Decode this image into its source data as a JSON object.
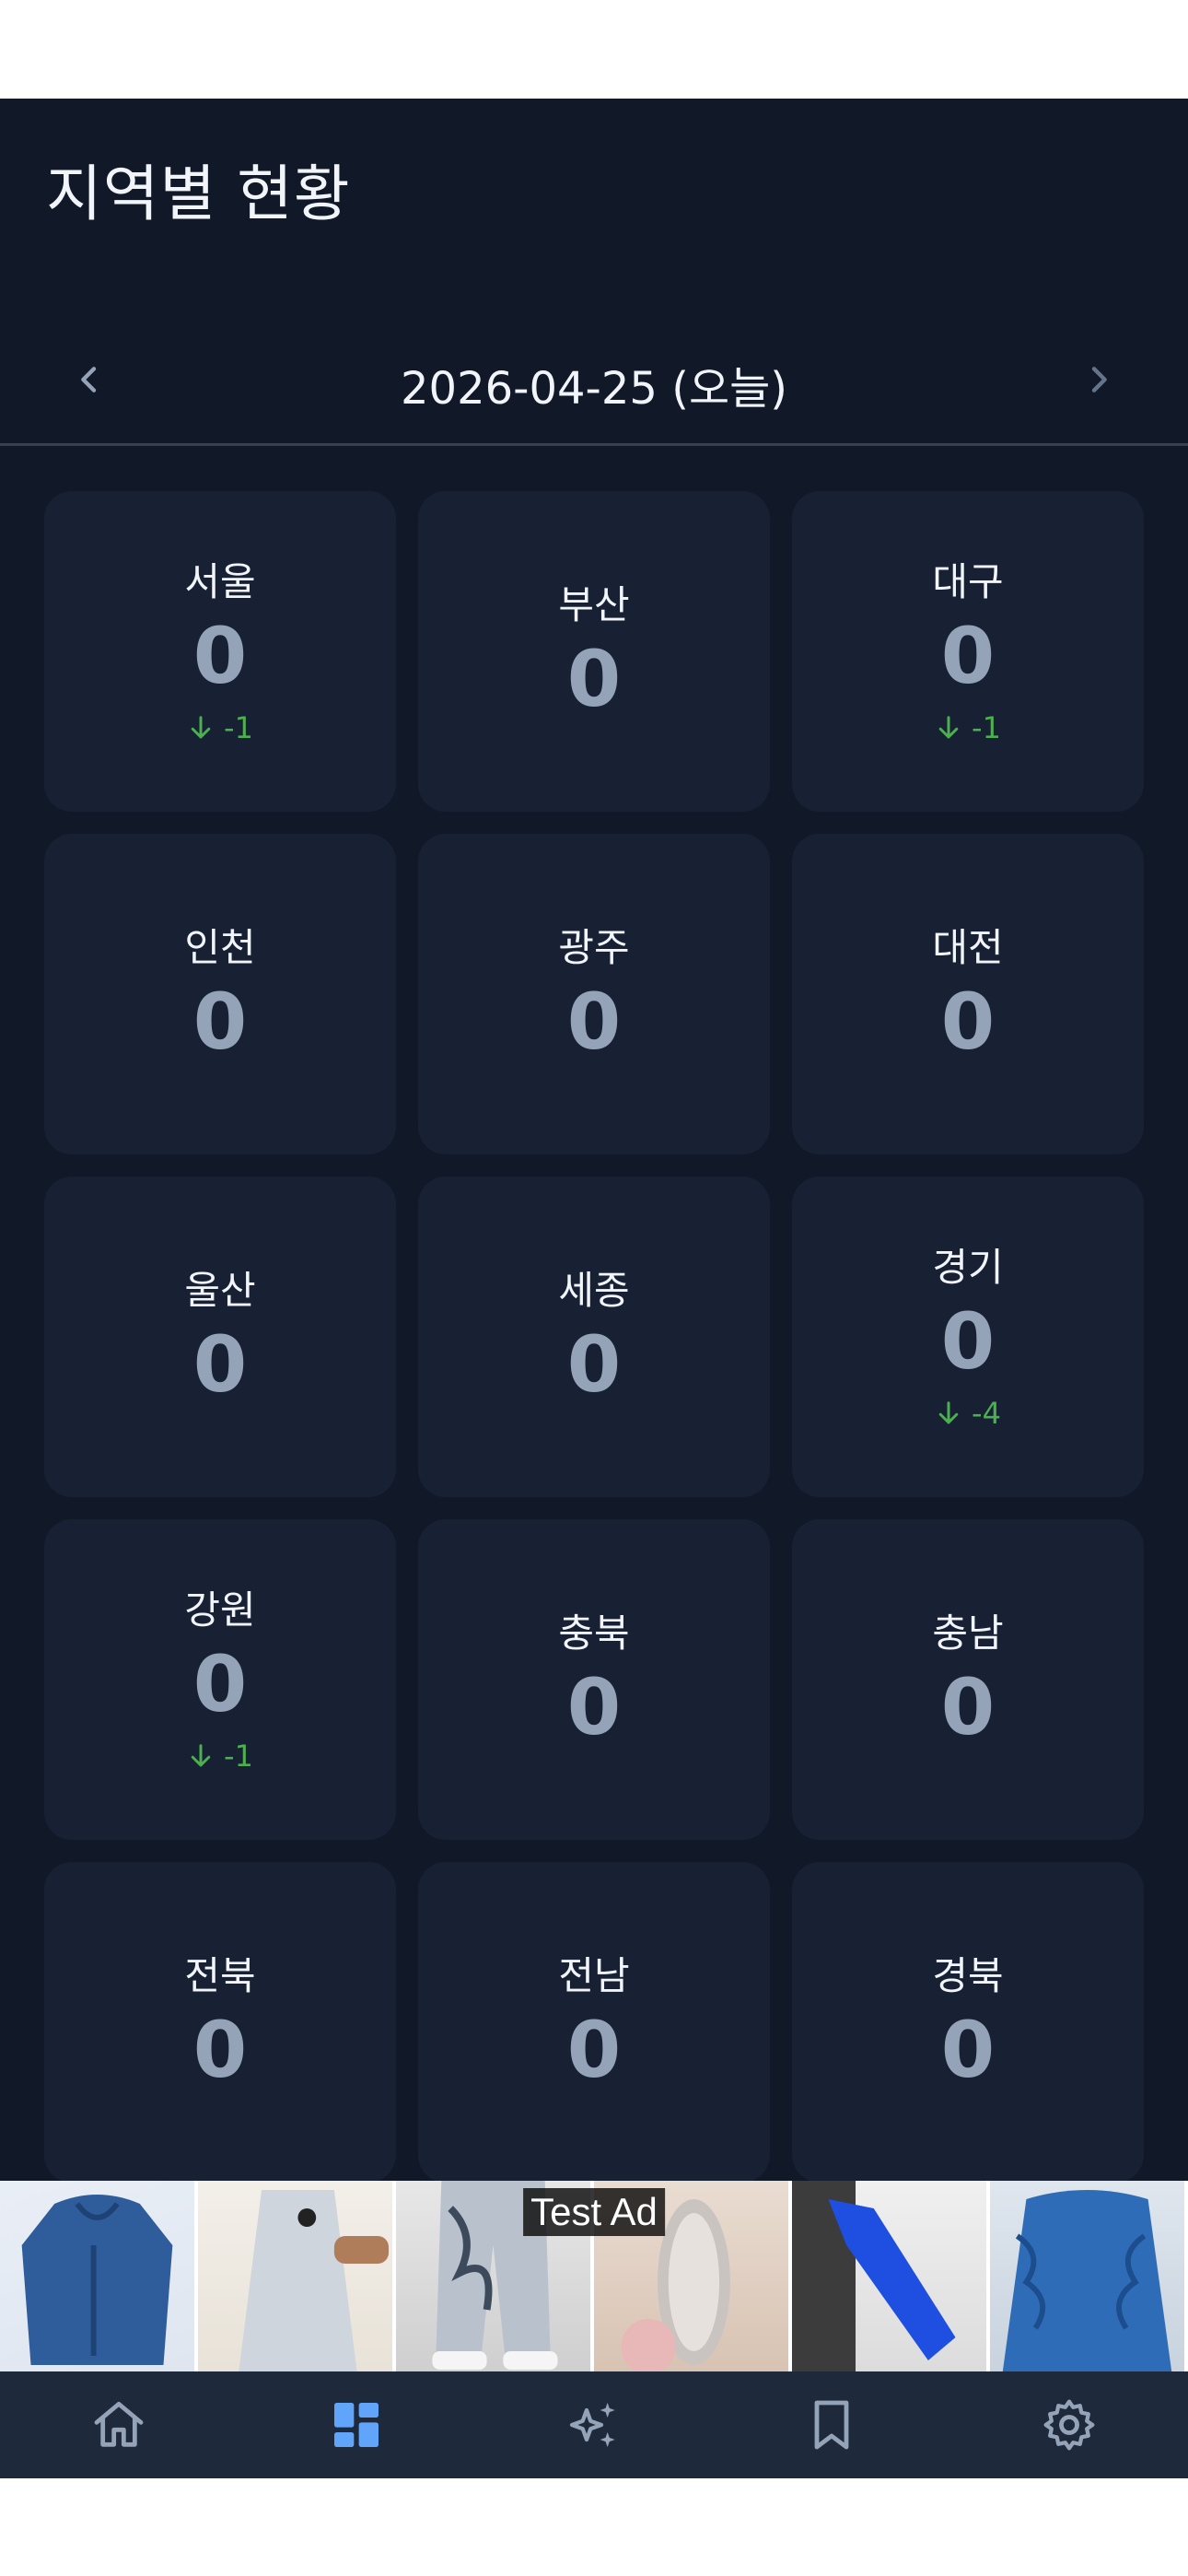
{
  "header": {
    "title": "지역별 현황"
  },
  "date_nav": {
    "label": "2026-04-25 (오늘)",
    "prev_icon": "chevron-left-icon",
    "next_icon": "chevron-right-icon"
  },
  "colors": {
    "background": "#111827",
    "card": "#182033",
    "value": "#94a3b8",
    "delta_down": "#4caf50",
    "nav_active": "#60a5fa",
    "nav_inactive": "#94a3b8"
  },
  "regions": [
    {
      "name": "서울",
      "value": "0",
      "delta": "-1"
    },
    {
      "name": "부산",
      "value": "0",
      "delta": ""
    },
    {
      "name": "대구",
      "value": "0",
      "delta": "-1"
    },
    {
      "name": "인천",
      "value": "0",
      "delta": ""
    },
    {
      "name": "광주",
      "value": "0",
      "delta": ""
    },
    {
      "name": "대전",
      "value": "0",
      "delta": ""
    },
    {
      "name": "울산",
      "value": "0",
      "delta": ""
    },
    {
      "name": "세종",
      "value": "0",
      "delta": ""
    },
    {
      "name": "경기",
      "value": "0",
      "delta": "-4"
    },
    {
      "name": "강원",
      "value": "0",
      "delta": "-1"
    },
    {
      "name": "충북",
      "value": "0",
      "delta": ""
    },
    {
      "name": "충남",
      "value": "0",
      "delta": ""
    },
    {
      "name": "전북",
      "value": "0",
      "delta": ""
    },
    {
      "name": "전남",
      "value": "0",
      "delta": ""
    },
    {
      "name": "경북",
      "value": "0",
      "delta": ""
    }
  ],
  "ad": {
    "label": "Test Ad"
  },
  "bottom_nav": [
    {
      "icon": "home-icon",
      "active": false
    },
    {
      "icon": "dashboard-icon",
      "active": true
    },
    {
      "icon": "sparkles-icon",
      "active": false
    },
    {
      "icon": "bookmark-icon",
      "active": false
    },
    {
      "icon": "settings-icon",
      "active": false
    }
  ]
}
